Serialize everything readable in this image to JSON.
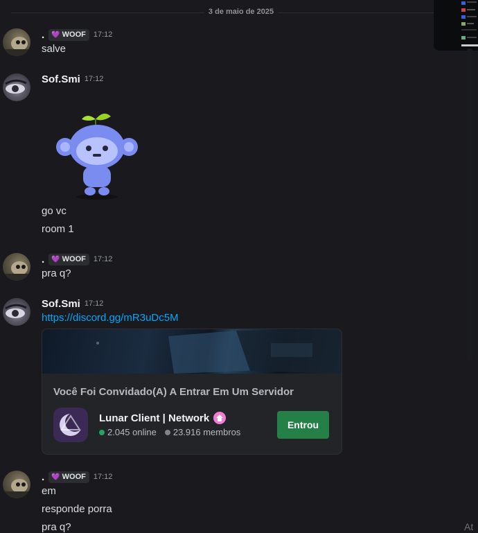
{
  "date_divider": "3 de maio de 2025",
  "messages": [
    {
      "author": ".",
      "tag": "WOOF",
      "time": "17:12",
      "lines": [
        "salve"
      ]
    },
    {
      "author": "Sof.Smi",
      "time": "17:12",
      "lines": [
        "go vc",
        "room 1"
      ],
      "sticker": "wumpus-leaf-sticker"
    },
    {
      "author": ".",
      "tag": "WOOF",
      "time": "17:12",
      "lines": [
        "pra q?"
      ]
    },
    {
      "author": "Sof.Smi",
      "time": "17:12",
      "link": "https://discord.gg/mR3uDc5M"
    },
    {
      "author": ".",
      "tag": "WOOF",
      "time": "17:12",
      "lines": [
        "em",
        "responde porra",
        "pra q?"
      ]
    }
  ],
  "invite": {
    "title": "Você Foi Convidado(A) A Entrar Em Um Servidor",
    "server_name": "Lunar Client | Network",
    "online": "2.045 online",
    "members": "23.916 membros",
    "join_label": "Entrou",
    "online_color": "#23a55a",
    "members_color": "#80848e"
  },
  "corner_text": "At"
}
